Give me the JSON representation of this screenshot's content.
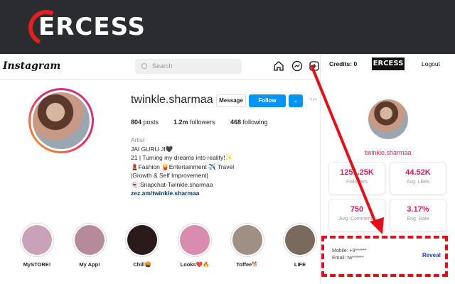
{
  "banner": {
    "brand": "ERCESS"
  },
  "instagram": {
    "logo": "Instagram",
    "search_placeholder": "Search",
    "username": "twinkle.sharmaa",
    "buttons": {
      "message": "Message",
      "follow": "Follow",
      "more": "⌄",
      "dots": "···"
    },
    "stats": {
      "posts_n": "804",
      "posts_l": "posts",
      "followers_n": "1.2m",
      "followers_l": "followers",
      "following_n": "468",
      "following_l": "following"
    },
    "bio": {
      "role": "Artist",
      "line1": "JAI GURU JI🖤",
      "line2": "21 | Turning my dreams into reality!✨",
      "line3": "💄Fashion 🍟Entertainment ✈️ Travel",
      "line4": "|Growth & Self Improvement|",
      "line5": "👻:Snapchat-Twinkle.sharmaa",
      "link": "zez.am/twinkle.sharmaa"
    },
    "highlights": [
      {
        "label": "MySTORE!",
        "color": "#c9a2b8"
      },
      {
        "label": "My App!",
        "color": "#b58a9a"
      },
      {
        "label": "Chill🤬",
        "color": "#2a1a1a"
      },
      {
        "label": "Looks❤️🔥",
        "color": "#d98bb0"
      },
      {
        "label": "Toffee🐕",
        "color": "#9f8f84"
      },
      {
        "label": "LIFE",
        "color": "#7a6a5e"
      }
    ]
  },
  "panel": {
    "credits": "Credits: 0",
    "brand": "ERCESS",
    "logout": "Logout",
    "name": "twinkle.sharmaa",
    "cards": [
      {
        "value": "1251.25K",
        "label": "Followers"
      },
      {
        "value": "44.52K",
        "label": "Avg. Likes"
      },
      {
        "value": "750",
        "label": "Avg. Comments"
      },
      {
        "value": "3.17%",
        "label": "Eng. Rate"
      }
    ],
    "mobile": "Mobile: +9******",
    "email": "Email: tw******",
    "reveal": "Reveal"
  }
}
